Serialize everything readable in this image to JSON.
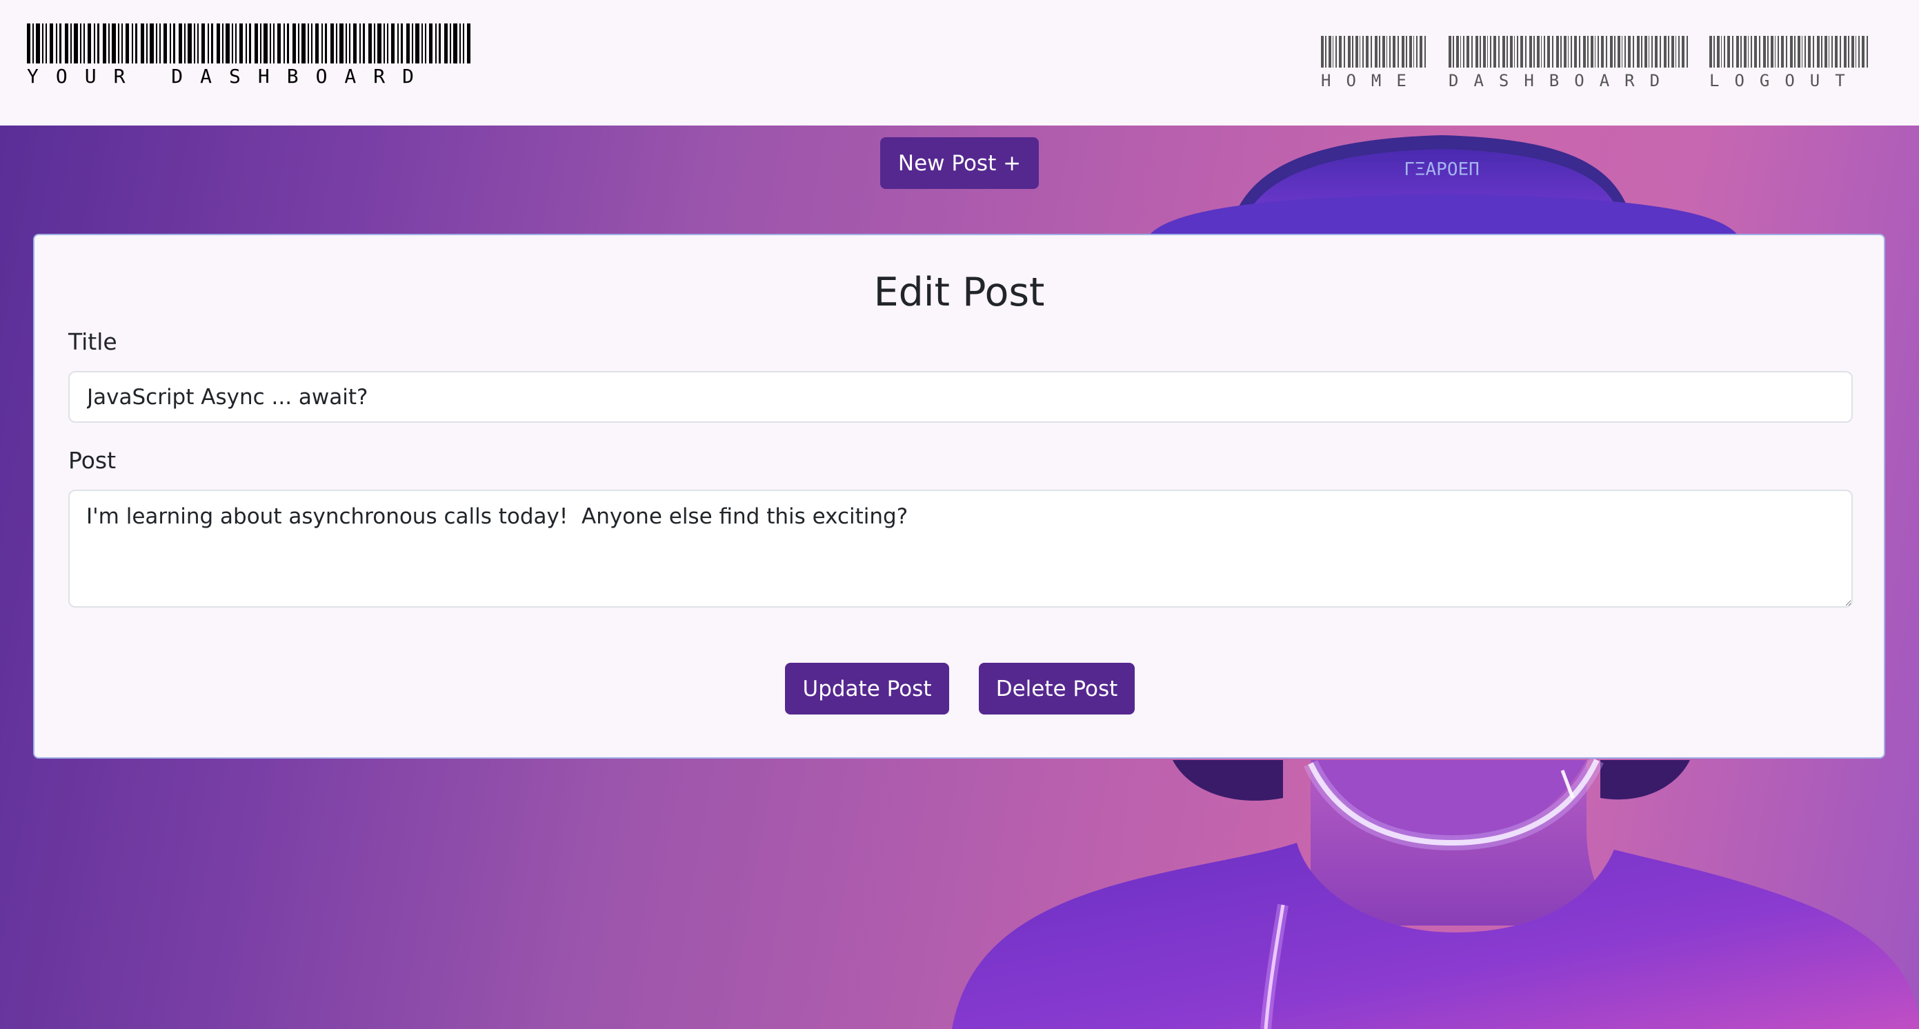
{
  "header": {
    "logo_text": "YOUR DASHBOARD",
    "nav": {
      "home": "HOME",
      "dashboard": "DASHBOARD",
      "logout": "LOGOUT"
    }
  },
  "actions": {
    "new_post_label": "New Post +"
  },
  "form": {
    "heading": "Edit Post",
    "title_label": "Title",
    "title_value": "JavaScript Async ... await?",
    "post_label": "Post",
    "post_value": "I'm learning about asynchronous calls today!  Anyone else find this exciting?",
    "update_label": "Update Post",
    "delete_label": "Delete Post"
  },
  "hero": {
    "headband_text": "ΓΞΑΡΟΕΠ"
  },
  "colors": {
    "accent": "#55288f",
    "page_bg": "#fbf5fc",
    "hero_left": "#5a2e97",
    "hero_right": "#c866ad"
  }
}
